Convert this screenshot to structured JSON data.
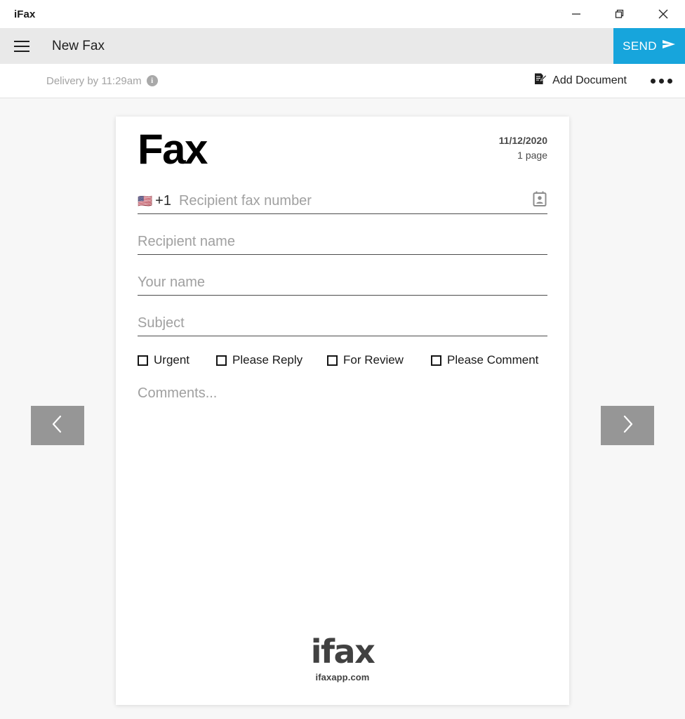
{
  "window": {
    "app_title": "iFax",
    "controls": [
      {
        "name": "minimize",
        "icon": "minimize-icon"
      },
      {
        "name": "restore",
        "icon": "restore-icon"
      },
      {
        "name": "close",
        "icon": "close-icon"
      }
    ]
  },
  "toolbar": {
    "menu_icon": "hamburger-menu-icon",
    "title": "New Fax",
    "send_label": "SEND",
    "send_icon": "send-paper-plane-icon",
    "accent_color": "#17a5dc"
  },
  "subbar": {
    "delivery_text": "Delivery by 11:29am",
    "info_icon": "info-icon",
    "info_glyph": "i",
    "add_document_label": "Add Document",
    "add_document_icon": "document-edit-icon",
    "more_icon": "more-options-icon"
  },
  "navigation": {
    "prev_icon": "chevron-left-icon",
    "next_icon": "chevron-right-icon",
    "button_color": "#969696"
  },
  "fax": {
    "title": "Fax",
    "date": "11/12/2020",
    "pages": "1 page",
    "phone": {
      "flag": "🇺🇸",
      "country_code": "+1",
      "placeholder": "Recipient fax number",
      "value": "",
      "contacts_icon": "contact-book-icon"
    },
    "fields": [
      {
        "name": "recipient-name",
        "placeholder": "Recipient name",
        "value": ""
      },
      {
        "name": "your-name",
        "placeholder": "Your name",
        "value": ""
      },
      {
        "name": "subject",
        "placeholder": "Subject",
        "value": ""
      }
    ],
    "checkboxes": [
      {
        "name": "urgent",
        "label": "Urgent",
        "checked": false
      },
      {
        "name": "please-reply",
        "label": "Please Reply",
        "checked": false
      },
      {
        "name": "for-review",
        "label": "For Review",
        "checked": false
      },
      {
        "name": "please-comment",
        "label": "Please Comment",
        "checked": false
      }
    ],
    "comments_placeholder": "Comments...",
    "footer": {
      "logo_text": "ifax",
      "url_text": "ifaxapp.com"
    }
  }
}
